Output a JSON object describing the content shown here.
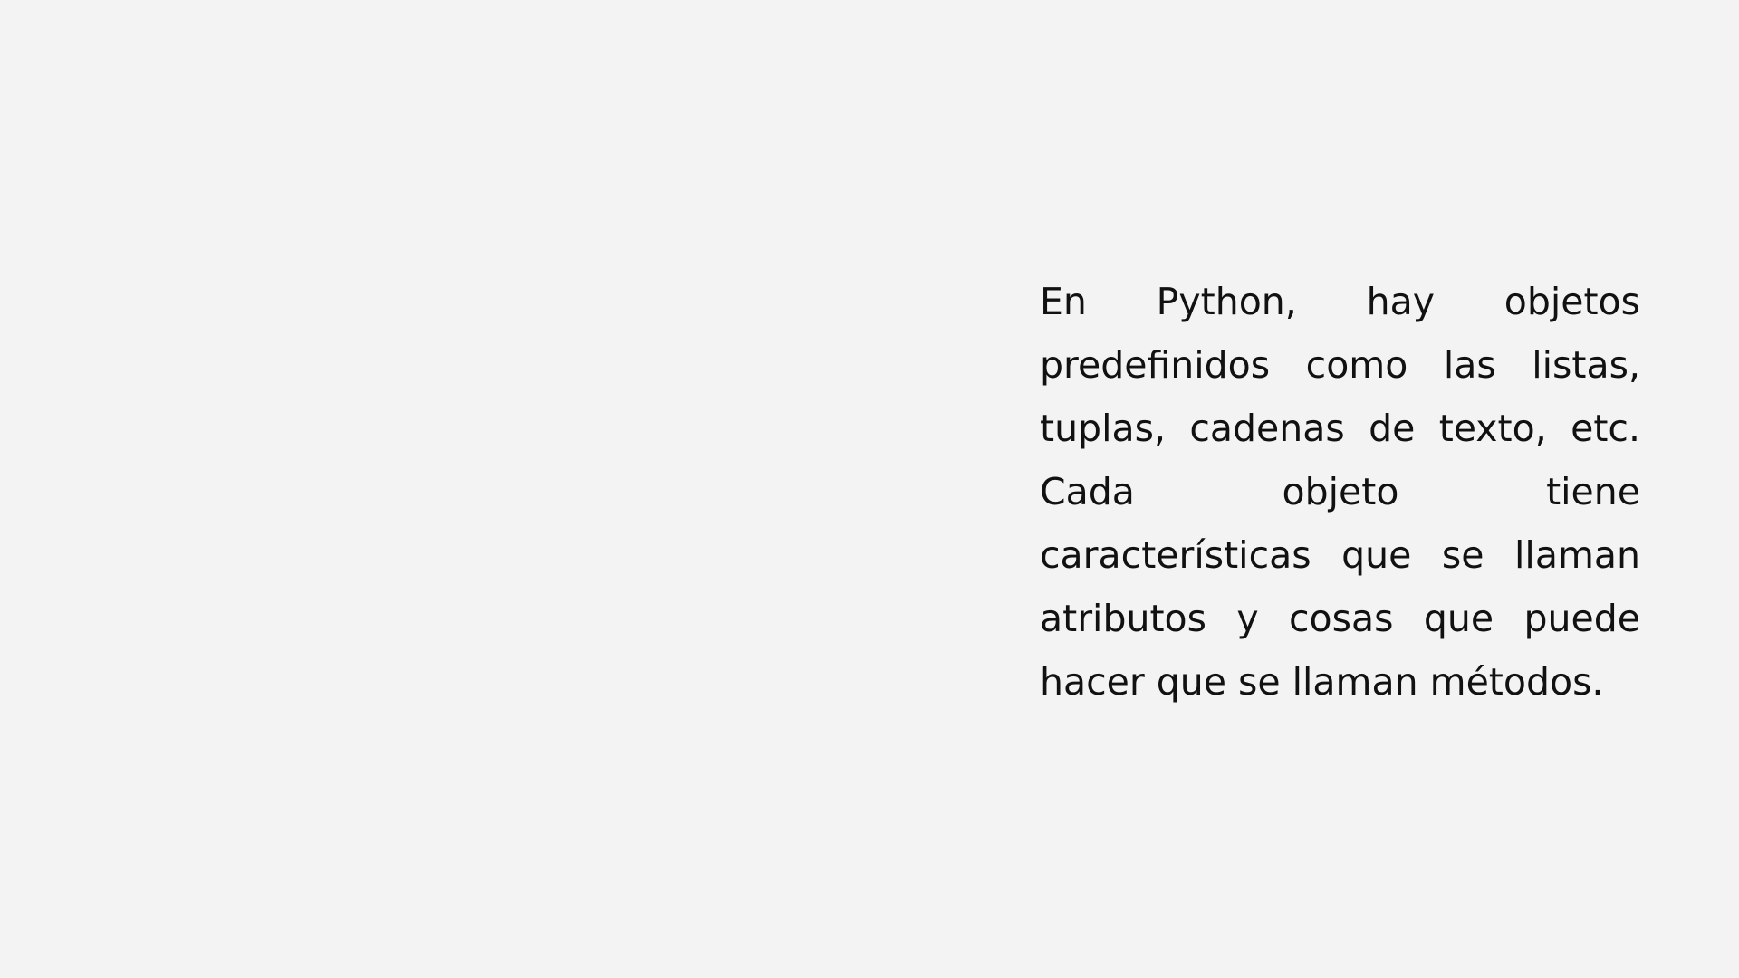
{
  "slide": {
    "paragraph_lines": [
      "En Python, hay objetos",
      "predefinidos como las listas,",
      "tuplas, cadenas de texto, etc.",
      "Cada objeto tiene",
      "características que se llaman",
      "atributos y cosas que puede",
      "hacer que se llaman métodos."
    ]
  },
  "colors": {
    "background": "#f3f3f3",
    "text": "#111111"
  }
}
